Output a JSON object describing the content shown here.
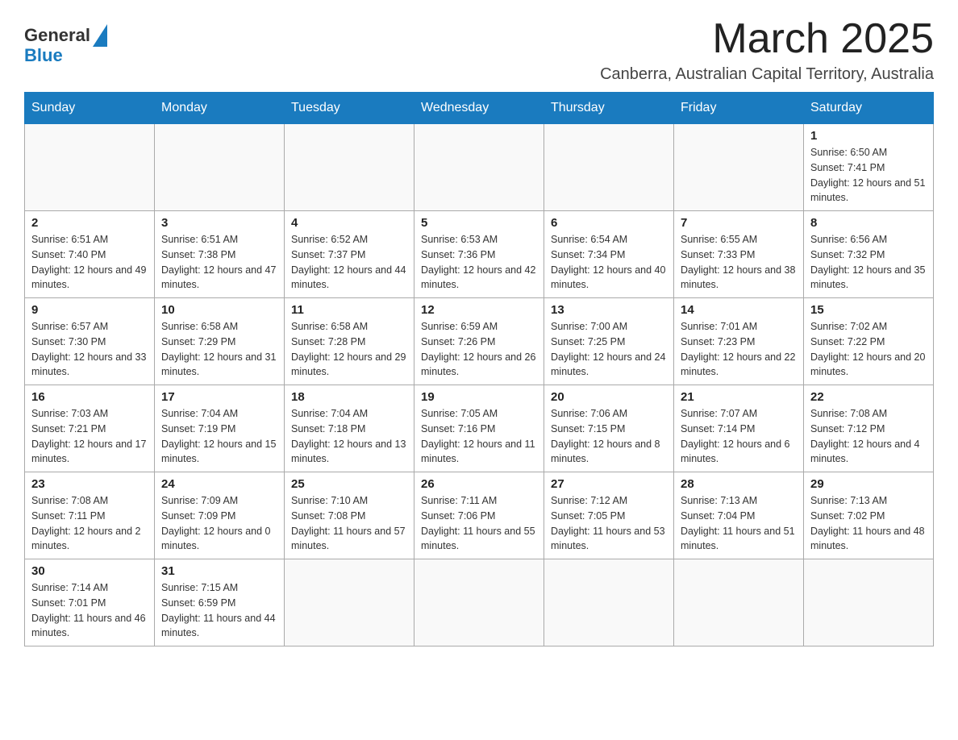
{
  "header": {
    "logo_general": "General",
    "logo_blue": "Blue",
    "month_title": "March 2025",
    "location": "Canberra, Australian Capital Territory, Australia"
  },
  "weekdays": [
    "Sunday",
    "Monday",
    "Tuesday",
    "Wednesday",
    "Thursday",
    "Friday",
    "Saturday"
  ],
  "weeks": [
    [
      {
        "day": "",
        "info": ""
      },
      {
        "day": "",
        "info": ""
      },
      {
        "day": "",
        "info": ""
      },
      {
        "day": "",
        "info": ""
      },
      {
        "day": "",
        "info": ""
      },
      {
        "day": "",
        "info": ""
      },
      {
        "day": "1",
        "info": "Sunrise: 6:50 AM\nSunset: 7:41 PM\nDaylight: 12 hours and 51 minutes."
      }
    ],
    [
      {
        "day": "2",
        "info": "Sunrise: 6:51 AM\nSunset: 7:40 PM\nDaylight: 12 hours and 49 minutes."
      },
      {
        "day": "3",
        "info": "Sunrise: 6:51 AM\nSunset: 7:38 PM\nDaylight: 12 hours and 47 minutes."
      },
      {
        "day": "4",
        "info": "Sunrise: 6:52 AM\nSunset: 7:37 PM\nDaylight: 12 hours and 44 minutes."
      },
      {
        "day": "5",
        "info": "Sunrise: 6:53 AM\nSunset: 7:36 PM\nDaylight: 12 hours and 42 minutes."
      },
      {
        "day": "6",
        "info": "Sunrise: 6:54 AM\nSunset: 7:34 PM\nDaylight: 12 hours and 40 minutes."
      },
      {
        "day": "7",
        "info": "Sunrise: 6:55 AM\nSunset: 7:33 PM\nDaylight: 12 hours and 38 minutes."
      },
      {
        "day": "8",
        "info": "Sunrise: 6:56 AM\nSunset: 7:32 PM\nDaylight: 12 hours and 35 minutes."
      }
    ],
    [
      {
        "day": "9",
        "info": "Sunrise: 6:57 AM\nSunset: 7:30 PM\nDaylight: 12 hours and 33 minutes."
      },
      {
        "day": "10",
        "info": "Sunrise: 6:58 AM\nSunset: 7:29 PM\nDaylight: 12 hours and 31 minutes."
      },
      {
        "day": "11",
        "info": "Sunrise: 6:58 AM\nSunset: 7:28 PM\nDaylight: 12 hours and 29 minutes."
      },
      {
        "day": "12",
        "info": "Sunrise: 6:59 AM\nSunset: 7:26 PM\nDaylight: 12 hours and 26 minutes."
      },
      {
        "day": "13",
        "info": "Sunrise: 7:00 AM\nSunset: 7:25 PM\nDaylight: 12 hours and 24 minutes."
      },
      {
        "day": "14",
        "info": "Sunrise: 7:01 AM\nSunset: 7:23 PM\nDaylight: 12 hours and 22 minutes."
      },
      {
        "day": "15",
        "info": "Sunrise: 7:02 AM\nSunset: 7:22 PM\nDaylight: 12 hours and 20 minutes."
      }
    ],
    [
      {
        "day": "16",
        "info": "Sunrise: 7:03 AM\nSunset: 7:21 PM\nDaylight: 12 hours and 17 minutes."
      },
      {
        "day": "17",
        "info": "Sunrise: 7:04 AM\nSunset: 7:19 PM\nDaylight: 12 hours and 15 minutes."
      },
      {
        "day": "18",
        "info": "Sunrise: 7:04 AM\nSunset: 7:18 PM\nDaylight: 12 hours and 13 minutes."
      },
      {
        "day": "19",
        "info": "Sunrise: 7:05 AM\nSunset: 7:16 PM\nDaylight: 12 hours and 11 minutes."
      },
      {
        "day": "20",
        "info": "Sunrise: 7:06 AM\nSunset: 7:15 PM\nDaylight: 12 hours and 8 minutes."
      },
      {
        "day": "21",
        "info": "Sunrise: 7:07 AM\nSunset: 7:14 PM\nDaylight: 12 hours and 6 minutes."
      },
      {
        "day": "22",
        "info": "Sunrise: 7:08 AM\nSunset: 7:12 PM\nDaylight: 12 hours and 4 minutes."
      }
    ],
    [
      {
        "day": "23",
        "info": "Sunrise: 7:08 AM\nSunset: 7:11 PM\nDaylight: 12 hours and 2 minutes."
      },
      {
        "day": "24",
        "info": "Sunrise: 7:09 AM\nSunset: 7:09 PM\nDaylight: 12 hours and 0 minutes."
      },
      {
        "day": "25",
        "info": "Sunrise: 7:10 AM\nSunset: 7:08 PM\nDaylight: 11 hours and 57 minutes."
      },
      {
        "day": "26",
        "info": "Sunrise: 7:11 AM\nSunset: 7:06 PM\nDaylight: 11 hours and 55 minutes."
      },
      {
        "day": "27",
        "info": "Sunrise: 7:12 AM\nSunset: 7:05 PM\nDaylight: 11 hours and 53 minutes."
      },
      {
        "day": "28",
        "info": "Sunrise: 7:13 AM\nSunset: 7:04 PM\nDaylight: 11 hours and 51 minutes."
      },
      {
        "day": "29",
        "info": "Sunrise: 7:13 AM\nSunset: 7:02 PM\nDaylight: 11 hours and 48 minutes."
      }
    ],
    [
      {
        "day": "30",
        "info": "Sunrise: 7:14 AM\nSunset: 7:01 PM\nDaylight: 11 hours and 46 minutes."
      },
      {
        "day": "31",
        "info": "Sunrise: 7:15 AM\nSunset: 6:59 PM\nDaylight: 11 hours and 44 minutes."
      },
      {
        "day": "",
        "info": ""
      },
      {
        "day": "",
        "info": ""
      },
      {
        "day": "",
        "info": ""
      },
      {
        "day": "",
        "info": ""
      },
      {
        "day": "",
        "info": ""
      }
    ]
  ]
}
